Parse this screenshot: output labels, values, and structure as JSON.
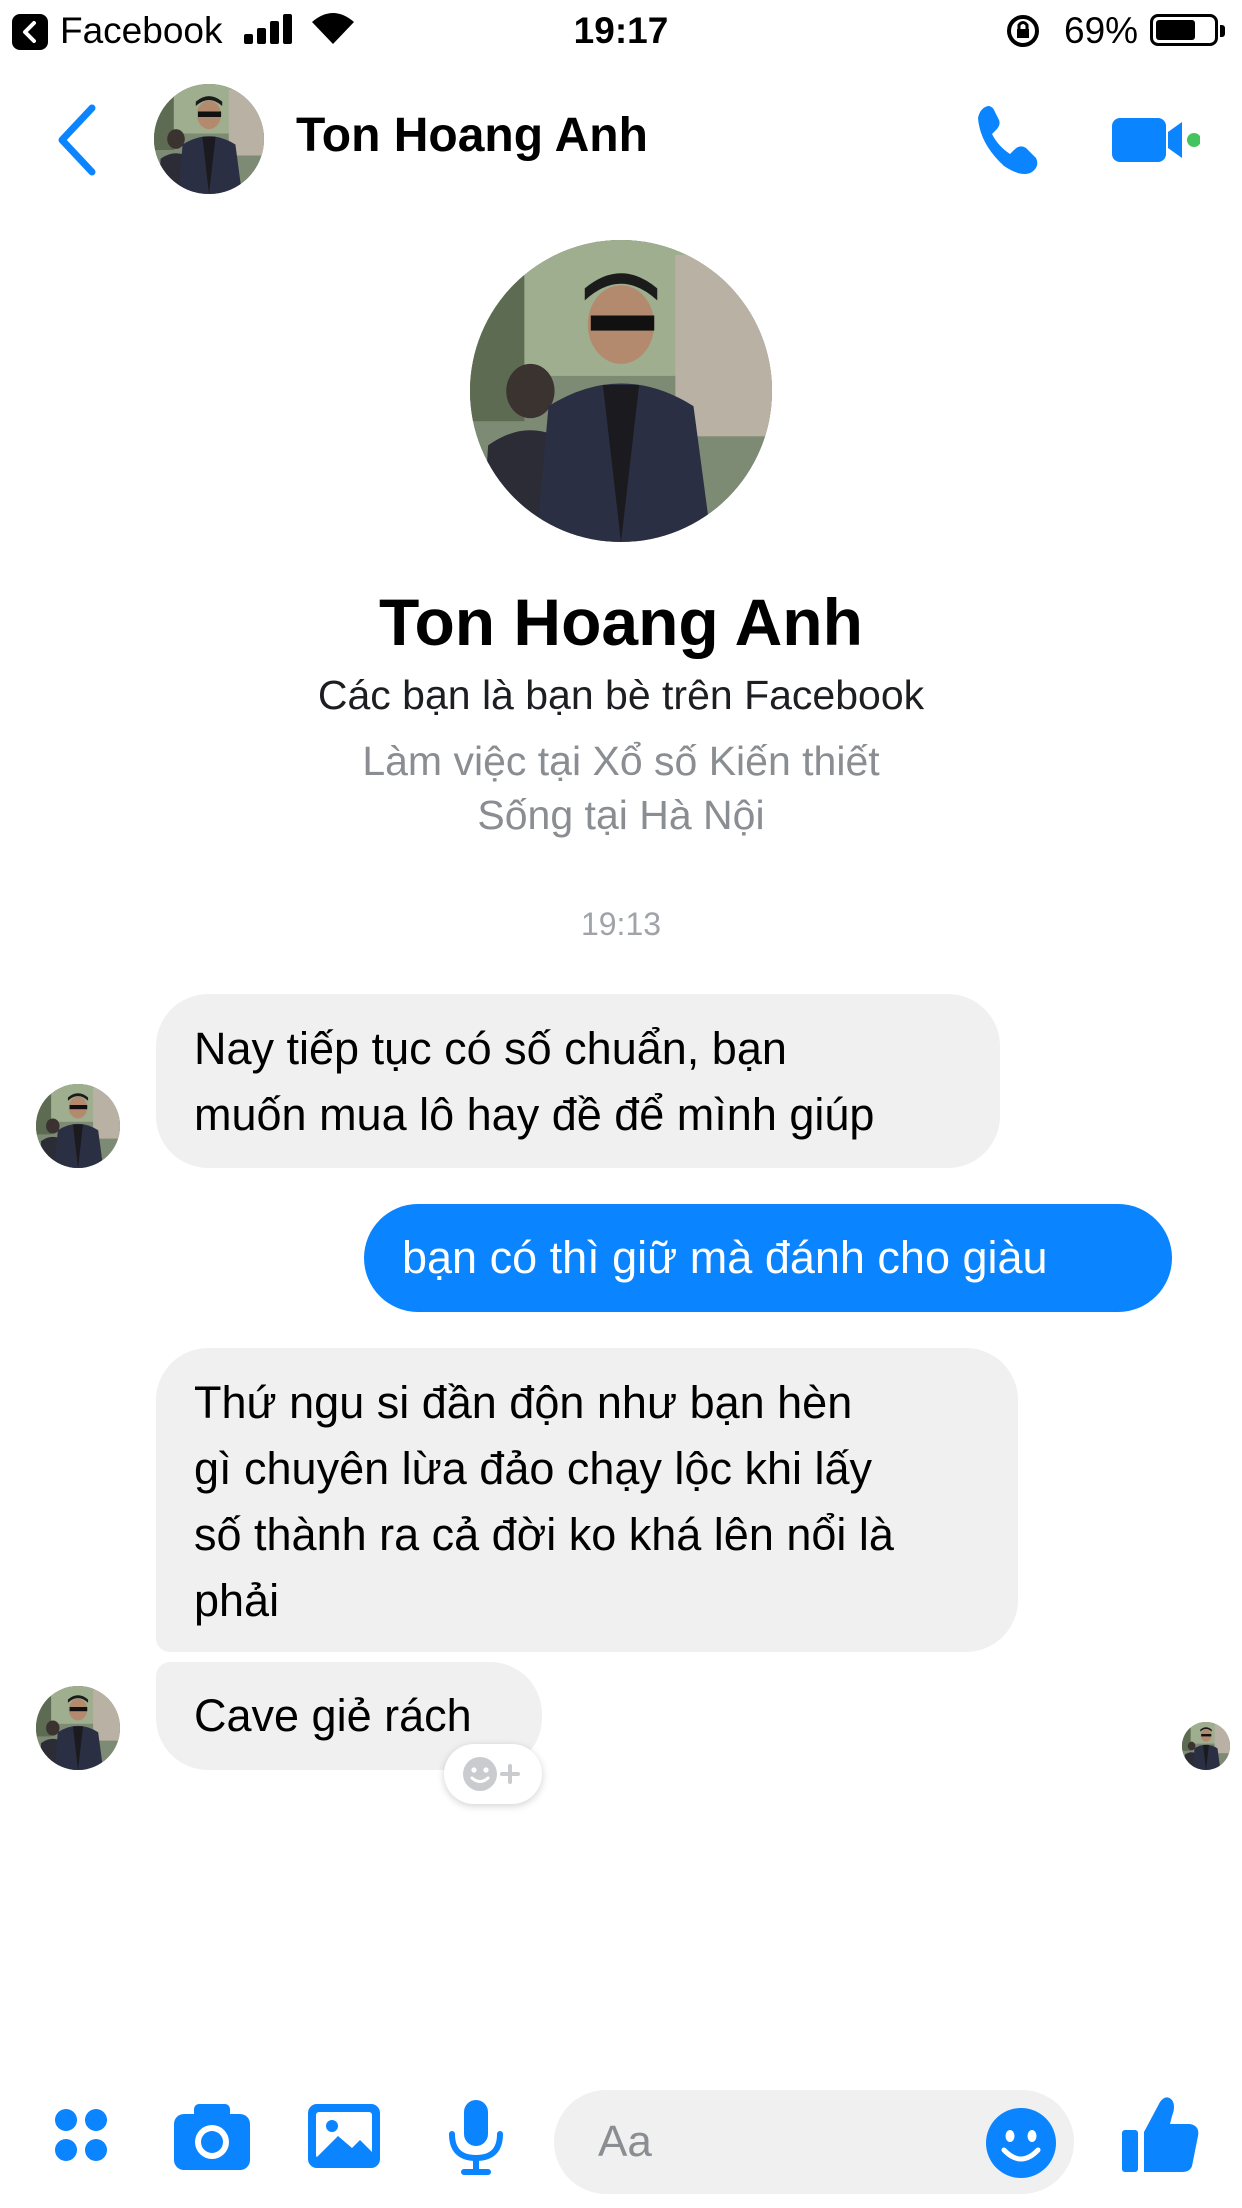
{
  "status_bar": {
    "back_app": "Facebook",
    "time": "19:17",
    "battery": "69%",
    "battery_level": 0.69
  },
  "header": {
    "name": "Ton Hoang Anh",
    "icons": [
      "chevron-left-icon",
      "phone-icon",
      "video-camera-icon"
    ],
    "active_status_color": "#44c45e"
  },
  "profile": {
    "name": "Ton Hoang Anh",
    "friends_text": "Các bạn là bạn bè trên Facebook",
    "work_text": "Làm việc tại Xổ số Kiến thiết",
    "lives_text": "Sống tại Hà Nội"
  },
  "conversation": {
    "timestamp": "19:13",
    "messages": [
      {
        "from": "contact",
        "lines": [
          "Nay tiếp tục có số chuẩn, bạn",
          "muốn mua lô hay đề để mình giúp"
        ]
      },
      {
        "from": "me",
        "lines": [
          "bạn có thì giữ mà đánh cho giàu"
        ]
      },
      {
        "from": "contact",
        "lines": [
          "Thứ ngu si đần độn như bạn hèn",
          "gì chuyên lừa đảo chạy lộc khi lấy",
          "số thành ra cả đời ko khá lên nổi là",
          "phải"
        ]
      },
      {
        "from": "contact",
        "lines": [
          "Cave giẻ rách"
        ]
      }
    ]
  },
  "composer": {
    "placeholder": "Aa",
    "icons": [
      "apps-icon",
      "camera-icon",
      "photo-icon",
      "microphone-icon",
      "emoji-icon",
      "thumbs-up-icon"
    ]
  },
  "colors": {
    "accent": "#0a84ff",
    "incoming_bubble": "#f1f0f0",
    "secondary_text": "#8a8d91"
  }
}
